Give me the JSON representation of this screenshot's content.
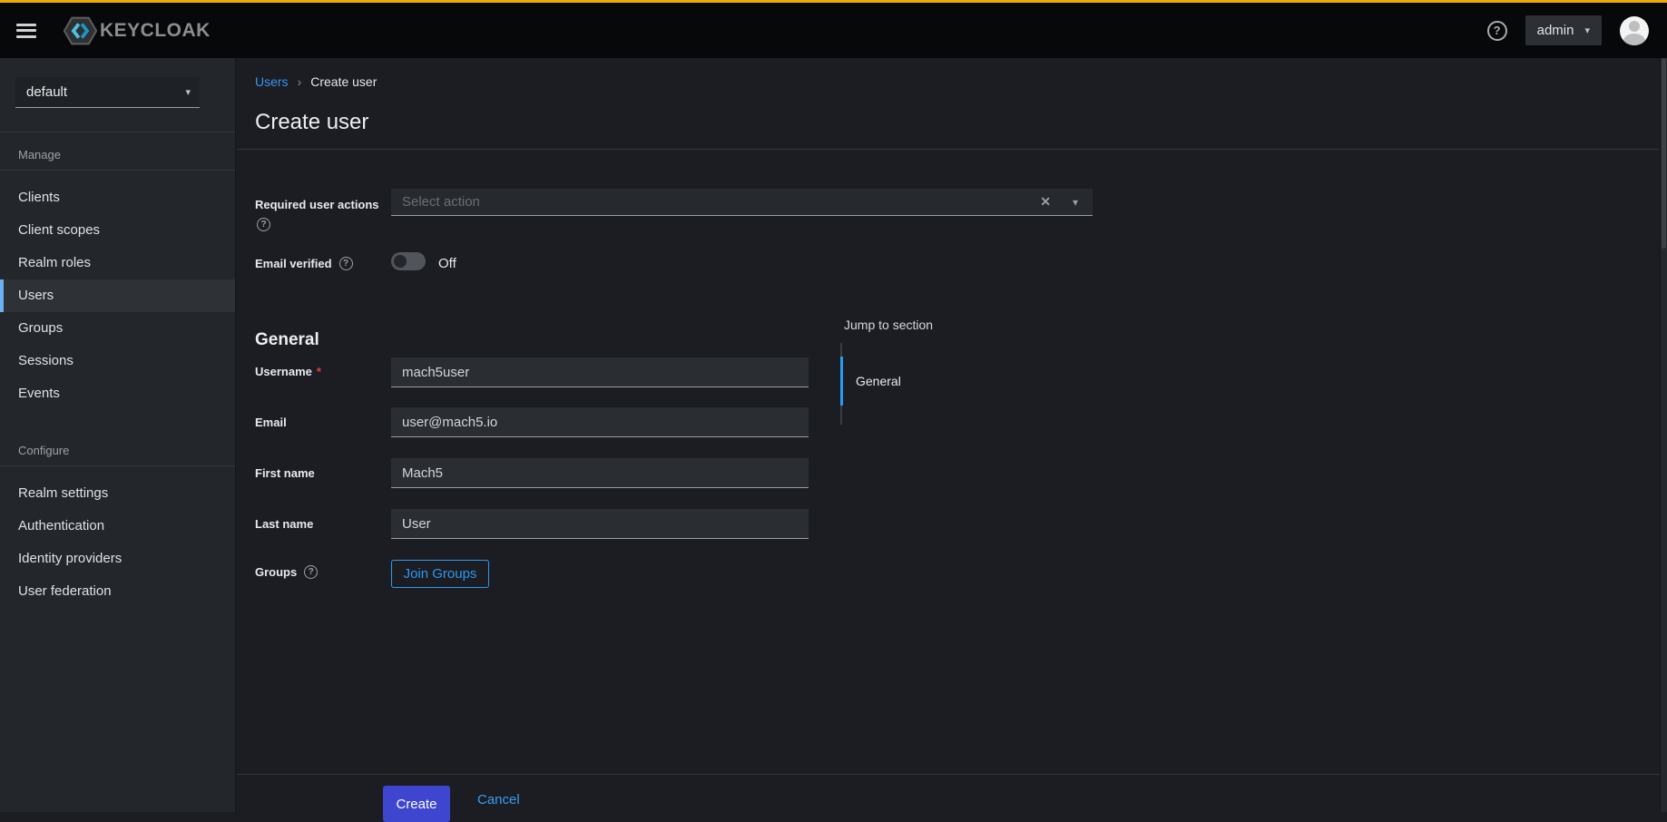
{
  "topbar": {
    "brand": "KEYCLOAK",
    "user_menu_label": "admin"
  },
  "icons": {
    "breadcrumb_separator": "›",
    "caret_down": "▾",
    "clear": "✕",
    "help_glyph": "?",
    "required_marker": "*"
  },
  "sidebar": {
    "realm_selector": {
      "value": "default"
    },
    "sections": [
      {
        "title": "Manage",
        "items": [
          {
            "label": "Clients",
            "active": false
          },
          {
            "label": "Client scopes",
            "active": false
          },
          {
            "label": "Realm roles",
            "active": false
          },
          {
            "label": "Users",
            "active": true
          },
          {
            "label": "Groups",
            "active": false
          },
          {
            "label": "Sessions",
            "active": false
          },
          {
            "label": "Events",
            "active": false
          }
        ]
      },
      {
        "title": "Configure",
        "items": [
          {
            "label": "Realm settings",
            "active": false
          },
          {
            "label": "Authentication",
            "active": false
          },
          {
            "label": "Identity providers",
            "active": false
          },
          {
            "label": "User federation",
            "active": false
          }
        ]
      }
    ]
  },
  "breadcrumb": {
    "link": "Users",
    "current": "Create user"
  },
  "page": {
    "title": "Create user"
  },
  "form": {
    "required_user_actions": {
      "label": "Required user actions",
      "placeholder": "Select action"
    },
    "email_verified": {
      "label": "Email verified",
      "state": "Off"
    },
    "section_heading": "General",
    "fields": [
      {
        "label": "Username",
        "value": "mach5user",
        "required": true
      },
      {
        "label": "Email",
        "value": "user@mach5.io"
      },
      {
        "label": "First name",
        "value": "Mach5"
      },
      {
        "label": "Last name",
        "value": "User"
      }
    ],
    "groups": {
      "label": "Groups",
      "button_label": "Join Groups"
    },
    "actions": {
      "create": "Create",
      "cancel": "Cancel"
    }
  },
  "jump_to_section": {
    "label": "Jump to section",
    "items": [
      {
        "label": "General",
        "active": true
      }
    ]
  },
  "colors": {
    "top_accent": "#f0ab00",
    "link_blue": "#2b9af3",
    "primary_button": "#3e45cf",
    "nav_active_indicator": "#6ab0f3",
    "required_red": "#e73f3f",
    "topbar_bg": "#07080a",
    "sidebar_bg": "#23262b",
    "page_bg": "#1b1d22",
    "input_bg": "#2a2d32"
  }
}
